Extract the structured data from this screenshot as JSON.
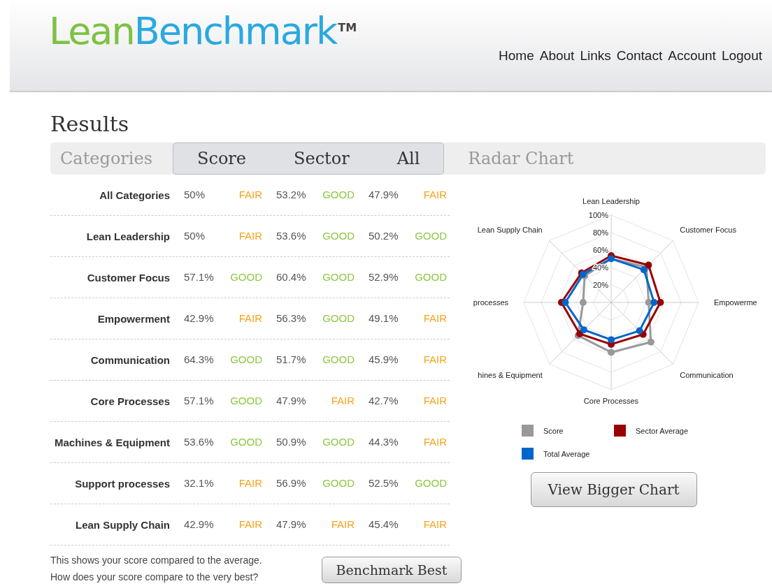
{
  "header": {
    "logo": {
      "part_1": "Lean",
      "part_2": "Benchmark",
      "trademark": "TM"
    },
    "nav": [
      "Home",
      "About",
      "Links",
      "Contact",
      "Account",
      "Logout"
    ]
  },
  "page_title": "Results",
  "column_headers": [
    {
      "label": "Categories",
      "highlighted": false
    },
    {
      "label": "Score",
      "highlighted": true
    },
    {
      "label": "Sector",
      "highlighted": true
    },
    {
      "label": "All",
      "highlighted": true
    },
    {
      "label": "Radar Chart",
      "highlighted": false
    }
  ],
  "table": {
    "rows": [
      {
        "category": "All Categories",
        "score": "50%",
        "score_rating": {
          "text": "FAIR",
          "kind": "fair"
        },
        "sector": "53.2%",
        "sector_rating": {
          "text": "GOOD",
          "kind": "good"
        },
        "all": "47.9%",
        "all_rating": {
          "text": "FAIR",
          "kind": "fair"
        }
      },
      {
        "category": "Lean Leadership",
        "score": "50%",
        "score_rating": {
          "text": "FAIR",
          "kind": "fair"
        },
        "sector": "53.6%",
        "sector_rating": {
          "text": "GOOD",
          "kind": "good"
        },
        "all": "50.2%",
        "all_rating": {
          "text": "GOOD",
          "kind": "good"
        }
      },
      {
        "category": "Customer Focus",
        "score": "57.1%",
        "score_rating": {
          "text": "GOOD",
          "kind": "good"
        },
        "sector": "60.4%",
        "sector_rating": {
          "text": "GOOD",
          "kind": "good"
        },
        "all": "52.9%",
        "all_rating": {
          "text": "GOOD",
          "kind": "good"
        }
      },
      {
        "category": "Empowerment",
        "score": "42.9%",
        "score_rating": {
          "text": "FAIR",
          "kind": "fair"
        },
        "sector": "56.3%",
        "sector_rating": {
          "text": "GOOD",
          "kind": "good"
        },
        "all": "49.1%",
        "all_rating": {
          "text": "FAIR",
          "kind": "fair"
        }
      },
      {
        "category": "Communication",
        "score": "64.3%",
        "score_rating": {
          "text": "GOOD",
          "kind": "good"
        },
        "sector": "51.7%",
        "sector_rating": {
          "text": "GOOD",
          "kind": "good"
        },
        "all": "45.9%",
        "all_rating": {
          "text": "FAIR",
          "kind": "fair"
        }
      },
      {
        "category": "Core Processes",
        "score": "57.1%",
        "score_rating": {
          "text": "GOOD",
          "kind": "good"
        },
        "sector": "47.9%",
        "sector_rating": {
          "text": "FAIR",
          "kind": "fair"
        },
        "all": "42.7%",
        "all_rating": {
          "text": "FAIR",
          "kind": "fair"
        }
      },
      {
        "category": "Machines & Equipment",
        "score": "53.6%",
        "score_rating": {
          "text": "GOOD",
          "kind": "good"
        },
        "sector": "50.9%",
        "sector_rating": {
          "text": "GOOD",
          "kind": "good"
        },
        "all": "44.3%",
        "all_rating": {
          "text": "FAIR",
          "kind": "fair"
        }
      },
      {
        "category": "Support processes",
        "score": "32.1%",
        "score_rating": {
          "text": "FAIR",
          "kind": "fair"
        },
        "sector": "56.9%",
        "sector_rating": {
          "text": "GOOD",
          "kind": "good"
        },
        "all": "52.5%",
        "all_rating": {
          "text": "GOOD",
          "kind": "good"
        }
      },
      {
        "category": "Lean Supply Chain",
        "score": "42.9%",
        "score_rating": {
          "text": "FAIR",
          "kind": "fair"
        },
        "sector": "47.9%",
        "sector_rating": {
          "text": "FAIR",
          "kind": "fair"
        },
        "all": "45.4%",
        "all_rating": {
          "text": "FAIR",
          "kind": "fair"
        }
      }
    ]
  },
  "footer_note": {
    "lines": [
      "This shows your score compared to the average.",
      "How does your score compare to the very best?"
    ]
  },
  "benchmark_button": "Benchmark Best",
  "radar": {
    "axis_labels": [
      "Lean Leadership",
      "Lean Supply Chain",
      "Customer Focus",
      "processes",
      "Empowerme",
      "hines & Equipment",
      "Communication",
      "Core Processes"
    ],
    "tick_labels": [
      "100%",
      "80%",
      "60%",
      "40%",
      "20%"
    ],
    "legend": [
      {
        "name": "Score",
        "color": "#999999"
      },
      {
        "name": "Sector Average",
        "color": "#990000"
      },
      {
        "name": "Total Average",
        "color": "#0066cc"
      }
    ]
  },
  "bigger_chart_button": "View Bigger Chart"
}
